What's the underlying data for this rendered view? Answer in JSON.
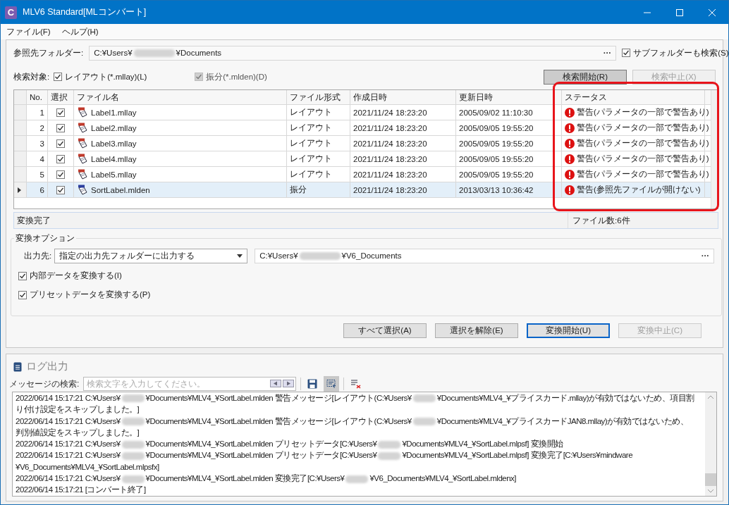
{
  "window": {
    "title": "MLV6 Standard[MLコンバート]",
    "app_letter": "C"
  },
  "menu": [
    "ファイル(F)",
    "ヘルプ(H)"
  ],
  "reference_folder": {
    "label": "参照先フォルダー:",
    "path_parts": [
      "C:¥Users¥",
      "¥Documents"
    ],
    "browse": "···",
    "subfolder": {
      "label": "サブフォルダーも検索(S)",
      "checked": true
    }
  },
  "search_target": {
    "label": "検索対象:",
    "options": [
      {
        "label": "レイアウト(*.mllay)(L)",
        "checked": true,
        "disabled": false
      },
      {
        "label": "振分(*.mlden)(D)",
        "checked": true,
        "disabled": true
      }
    ]
  },
  "search_buttons": [
    {
      "label": "検索開始(R)",
      "disabled": false,
      "pressed": true
    },
    {
      "label": "検索中止(X)",
      "disabled": true,
      "pressed": false
    }
  ],
  "table": {
    "columns": [
      "No.",
      "選択",
      "ファイル名",
      "ファイル形式",
      "作成日時",
      "更新日時",
      "ステータス"
    ],
    "rows": [
      {
        "no": "1",
        "checked": true,
        "kind": "layout",
        "name": "Label1.mllay",
        "format": "レイアウト",
        "created": "2021/11/24 18:23:20",
        "updated": "2005/09/02 11:10:30",
        "status": "警告(パラメータの一部で警告あり)",
        "selected": false
      },
      {
        "no": "2",
        "checked": true,
        "kind": "layout",
        "name": "Label2.mllay",
        "format": "レイアウト",
        "created": "2021/11/24 18:23:20",
        "updated": "2005/09/05 19:55:20",
        "status": "警告(パラメータの一部で警告あり)",
        "selected": false
      },
      {
        "no": "3",
        "checked": true,
        "kind": "layout",
        "name": "Label3.mllay",
        "format": "レイアウト",
        "created": "2021/11/24 18:23:20",
        "updated": "2005/09/05 19:55:20",
        "status": "警告(パラメータの一部で警告あり)",
        "selected": false
      },
      {
        "no": "4",
        "checked": true,
        "kind": "layout",
        "name": "Label4.mllay",
        "format": "レイアウト",
        "created": "2021/11/24 18:23:20",
        "updated": "2005/09/05 19:55:20",
        "status": "警告(パラメータの一部で警告あり)",
        "selected": false
      },
      {
        "no": "5",
        "checked": true,
        "kind": "layout",
        "name": "Label5.mllay",
        "format": "レイアウト",
        "created": "2021/11/24 18:23:20",
        "updated": "2005/09/05 19:55:20",
        "status": "警告(パラメータの一部で警告あり)",
        "selected": false
      },
      {
        "no": "6",
        "checked": true,
        "kind": "sort",
        "name": "SortLabel.mlden",
        "format": "振分",
        "created": "2021/11/24 18:23:20",
        "updated": "2013/03/13 10:36:42",
        "status": "警告(参照先ファイルが開けない)",
        "selected": true
      }
    ],
    "highlight": {
      "kind": "frame"
    }
  },
  "status_bar": {
    "message": "変換完了",
    "count": "ファイル数:6件"
  },
  "options": {
    "title": "変換オプション",
    "output_label": "出力先:",
    "output_mode": "指定の出力先フォルダーに出力する",
    "output_path_parts": [
      "C:¥Users¥",
      "¥V6_Documents"
    ],
    "browse": "···",
    "checks": [
      {
        "label": "内部データを変換する(I)",
        "checked": true
      },
      {
        "label": "プリセットデータを変換する(P)",
        "checked": true
      }
    ]
  },
  "action_buttons": [
    {
      "label": "すべて選択(A)",
      "disabled": false,
      "default": false
    },
    {
      "label": "選択を解除(E)",
      "disabled": false,
      "default": false
    },
    {
      "label": "変換開始(U)",
      "disabled": false,
      "default": true
    },
    {
      "label": "変換中止(C)",
      "disabled": true,
      "default": false
    }
  ],
  "log": {
    "title": "ログ出力",
    "search_label": "メッセージの検索:",
    "search_placeholder": "検索文字を入力してください。",
    "autoscroll_on": true,
    "lines": [
      {
        "parts": [
          "2022/06/14 15:17:21 C:¥Users¥",
          "¥Documents¥MLV4_¥SortLabel.mlden 警告メッセージ[レイアウト(C:¥Users¥",
          "¥Documents¥MLV4_¥プライスカード.mllay)が有効ではないため、項目割"
        ]
      },
      {
        "parts": [
          "り付け設定をスキップしました。]"
        ]
      },
      {
        "parts": [
          "2022/06/14 15:17:21 C:¥Users¥",
          "¥Documents¥MLV4_¥SortLabel.mlden 警告メッセージ[レイアウト(C:¥Users¥",
          "¥Documents¥MLV4_¥プライスカードJAN8.mllay)が有効ではないため、"
        ]
      },
      {
        "parts": [
          "判別値設定をスキップしました。]"
        ]
      },
      {
        "parts": [
          "2022/06/14 15:17:21 C:¥Users¥",
          "¥Documents¥MLV4_¥SortLabel.mlden プリセットデータ[C:¥Users¥",
          "¥Documents¥MLV4_¥SortLabel.mlpsf] 変換開始"
        ]
      },
      {
        "parts": [
          "2022/06/14 15:17:21 C:¥Users¥",
          "¥Documents¥MLV4_¥SortLabel.mlden プリセットデータ[C:¥Users¥",
          "¥Documents¥MLV4_¥SortLabel.mlpsf] 変換完了[C:¥Users¥mindware"
        ]
      },
      {
        "parts": [
          "¥V6_Documents¥MLV4_¥SortLabel.mlpsfx]"
        ]
      },
      {
        "parts": [
          "2022/06/14 15:17:21 C:¥Users¥",
          "¥Documents¥MLV4_¥SortLabel.mlden 変換完了[C:¥Users¥",
          "¥V6_Documents¥MLV4_¥SortLabel.mldenx]"
        ]
      },
      {
        "parts": [
          "2022/06/14 15:17:21 [コンバート終了]"
        ]
      }
    ]
  }
}
